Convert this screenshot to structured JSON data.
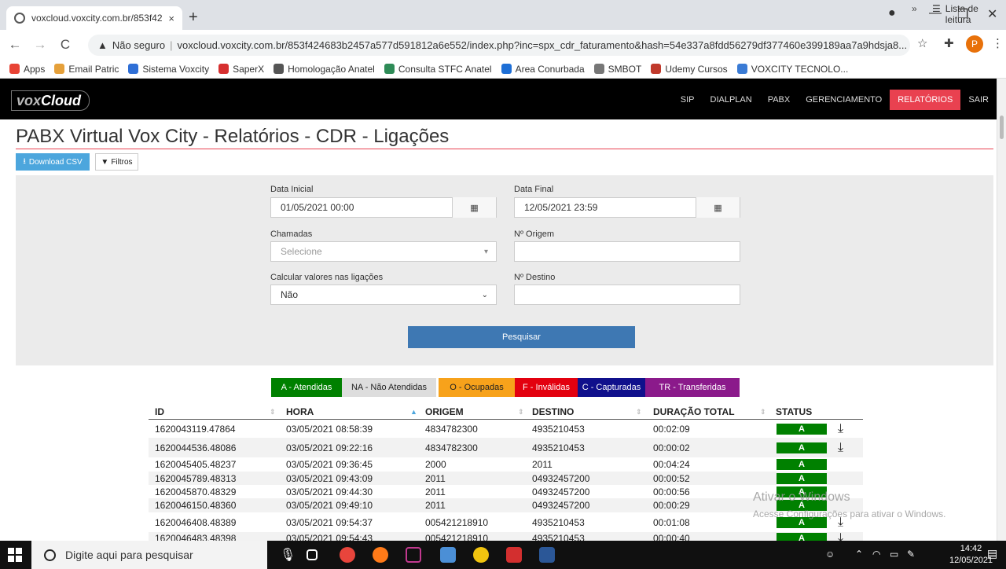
{
  "browser": {
    "tab_title": "voxcloud.voxcity.com.br/853f424",
    "tab_close": "×",
    "new_tab": "+",
    "not_secure": "Não seguro",
    "url": "voxcloud.voxcity.com.br/853f424683b2457a577d591812a6e552/index.php?inc=spx_cdr_faturamento&hash=54e337a8fdd56279df377460e399189aa7a9hdsja8...",
    "profile_letter": "P",
    "bookmarks": [
      {
        "label": "Apps",
        "color": "#e84335"
      },
      {
        "label": "Email Patric",
        "color": "#e5a03a"
      },
      {
        "label": "Sistema Voxcity",
        "color": "#2f6fd6"
      },
      {
        "label": "SaperX",
        "color": "#d62f2f"
      },
      {
        "label": "Homologação Anatel",
        "color": "#555555"
      },
      {
        "label": "Consulta STFC Anatel",
        "color": "#2e8b57"
      },
      {
        "label": "Area Conurbada",
        "color": "#1e6fd6"
      },
      {
        "label": "SMBOT",
        "color": "#777777"
      },
      {
        "label": "Udemy Cursos",
        "color": "#c0392b"
      },
      {
        "label": "VOXCITY TECNOLO...",
        "color": "#3a7bd5"
      }
    ],
    "bookmarks_more": "»",
    "reading_list": "Lista de leitura"
  },
  "app": {
    "logo_prefix": "vox",
    "logo_suffix": "Cloud",
    "menu": [
      "SIP",
      "DIALPLAN",
      "PABX",
      "GERENCIAMENTO",
      "RELATÓRIOS",
      "SAIR"
    ],
    "active_menu": "RELATÓRIOS",
    "accent_color": "#e94150"
  },
  "page": {
    "title": "PABX Virtual Vox City - Relatórios - CDR - Ligações",
    "download_csv": "Download CSV",
    "filters": "Filtros"
  },
  "form": {
    "data_inicial_label": "Data Inicial",
    "data_inicial_value": "01/05/2021 00:00",
    "data_final_label": "Data Final",
    "data_final_value": "12/05/2021 23:59",
    "chamadas_label": "Chamadas",
    "chamadas_placeholder": "Selecione",
    "origem_label": "Nº Origem",
    "calcular_label": "Calcular valores nas ligações",
    "calcular_value": "Não",
    "destino_label": "Nº Destino",
    "search_button": "Pesquisar"
  },
  "legend": [
    {
      "label": "A - Atendidas",
      "bg": "#008000",
      "fg": "#ffffff"
    },
    {
      "label": "NA - Não Atendidas",
      "bg": "#dddddd",
      "fg": "#222222"
    },
    {
      "label": "O - Ocupadas",
      "bg": "#f7a21b",
      "fg": "#222222"
    },
    {
      "label": "F - Inválidas",
      "bg": "#e3000f",
      "fg": "#ffffff"
    },
    {
      "label": "C - Capturadas",
      "bg": "#10108c",
      "fg": "#ffffff"
    },
    {
      "label": "TR - Transferidas",
      "bg": "#8b1a8b",
      "fg": "#ffffff"
    }
  ],
  "table": {
    "columns": [
      "ID",
      "HORA",
      "ORIGEM",
      "DESTINO",
      "DURAÇÃO TOTAL",
      "STATUS"
    ],
    "rows": [
      {
        "id": "1620043119.47864",
        "hora": "03/05/2021 08:58:39",
        "origem": "4834782300",
        "destino": "4935210453",
        "duracao": "00:02:09",
        "status": "A",
        "download": true
      },
      {
        "id": "1620044536.48086",
        "hora": "03/05/2021 09:22:16",
        "origem": "4834782300",
        "destino": "4935210453",
        "duracao": "00:00:02",
        "status": "A",
        "download": true
      },
      {
        "id": "1620045405.48237",
        "hora": "03/05/2021 09:36:45",
        "origem": "2000",
        "destino": "2011",
        "duracao": "00:04:24",
        "status": "A",
        "download": false
      },
      {
        "id": "1620045789.48313",
        "hora": "03/05/2021 09:43:09",
        "origem": "2011",
        "destino": "04932457200",
        "duracao": "00:00:52",
        "status": "A",
        "download": false
      },
      {
        "id": "1620045870.48329",
        "hora": "03/05/2021 09:44:30",
        "origem": "2011",
        "destino": "04932457200",
        "duracao": "00:00:56",
        "status": "A",
        "download": false
      },
      {
        "id": "1620046150.48360",
        "hora": "03/05/2021 09:49:10",
        "origem": "2011",
        "destino": "04932457200",
        "duracao": "00:00:29",
        "status": "A",
        "download": false
      },
      {
        "id": "1620046408.48389",
        "hora": "03/05/2021 09:54:37",
        "origem": "005421218910",
        "destino": "4935210453",
        "duracao": "00:01:08",
        "status": "A",
        "download": true
      },
      {
        "id": "1620046483.48398",
        "hora": "03/05/2021 09:54:43",
        "origem": "005421218910",
        "destino": "4935210453",
        "duracao": "00:00:40",
        "status": "A",
        "download": true
      }
    ]
  },
  "watermark": {
    "line1": "Ativar o Windows",
    "line2": "Acesse Configurações para ativar o Windows."
  },
  "taskbar": {
    "search_placeholder": "Digite aqui para pesquisar",
    "time": "14:42",
    "date": "12/05/2021"
  }
}
